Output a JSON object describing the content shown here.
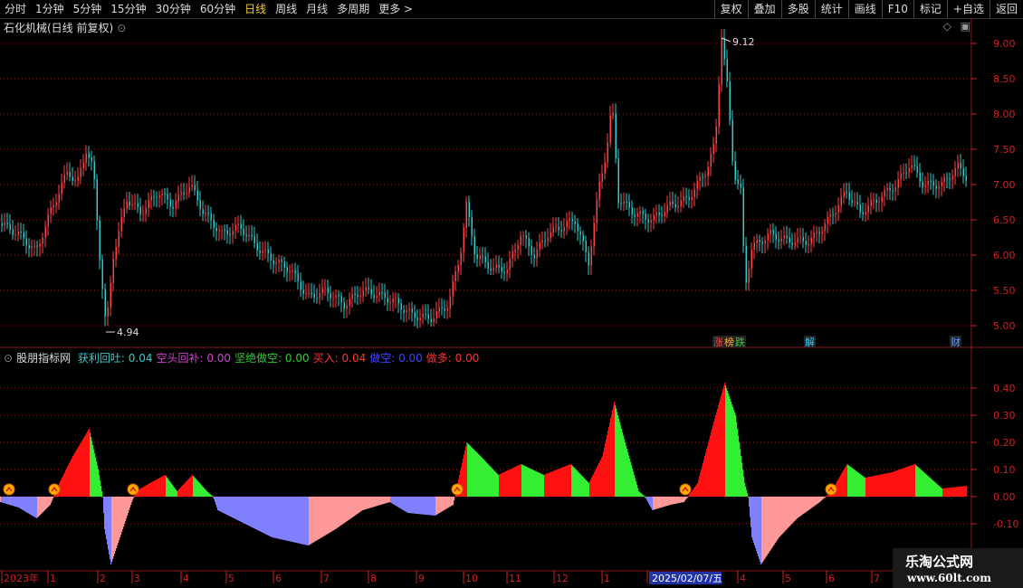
{
  "toolbar": {
    "periods": [
      "分时",
      "1分钟",
      "5分钟",
      "15分钟",
      "30分钟",
      "60分钟",
      "日线",
      "周线",
      "月线",
      "多周期",
      "更多 >"
    ],
    "active_period": "日线",
    "right_buttons": [
      "复权",
      "叠加",
      "多股",
      "统计",
      "画线",
      "F10",
      "标记",
      "+自选",
      "返回"
    ]
  },
  "main_chart": {
    "title": "石化机械(日线 前复权)",
    "price_axis": [
      "9.00",
      "8.50",
      "8.00",
      "7.50",
      "7.00",
      "6.50",
      "6.00",
      "5.50",
      "5.00"
    ],
    "high_label": "9.12",
    "low_label": "4.94",
    "events": [
      {
        "text": "涨",
        "color": "#ff4444"
      },
      {
        "text": "榜",
        "color": "#ffaa33"
      },
      {
        "text": "跌",
        "color": "#33cc33"
      },
      {
        "text": "解",
        "color": "#33ccff"
      },
      {
        "text": "财",
        "color": "#6699ff"
      }
    ]
  },
  "indicator": {
    "name": "股朋指标网",
    "items": [
      {
        "label": "获利回吐:",
        "value": "0.04",
        "color": "#33cccc"
      },
      {
        "label": "空头回补:",
        "value": "0.00",
        "color": "#cc44cc"
      },
      {
        "label": "坚绝做空:",
        "value": "0.00",
        "color": "#33cc33"
      },
      {
        "label": "买入:",
        "value": "0.04",
        "color": "#ff3333"
      },
      {
        "label": "做空:",
        "value": "0.00",
        "color": "#4444ff"
      },
      {
        "label": "做多:",
        "value": "0.00",
        "color": "#ff3333"
      }
    ],
    "axis": [
      "0.40",
      "0.30",
      "0.20",
      "0.10",
      "0.00",
      "-0.10"
    ]
  },
  "time_axis": {
    "labels": [
      "2023年",
      "1",
      "2",
      "3",
      "4",
      "5",
      "6",
      "7",
      "8",
      "9",
      "10",
      "11",
      "12",
      "1",
      "2",
      "3",
      "4",
      "5",
      "6",
      "7"
    ],
    "cursor_date": "2025/02/07/五"
  },
  "watermark": {
    "line1": "乐淘公式网",
    "line2": "www.60lt.com"
  },
  "colors": {
    "up": "#ff4444",
    "down": "#33cccc",
    "grid": "#8b1a1a",
    "axis": "#cc2222"
  }
}
